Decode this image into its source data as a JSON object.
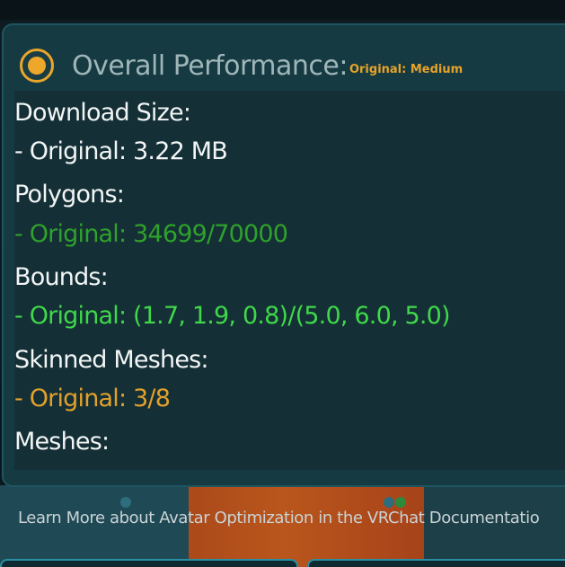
{
  "performance": {
    "title": "Overall Performance:",
    "rating_badge": "Original: Medium",
    "rating_color": "#e9a62a",
    "icon": "performance-rating-icon"
  },
  "stats": [
    {
      "label": "Download Size:",
      "value": "- Original: 3.22 MB",
      "value_color": "#f2f5f5"
    },
    {
      "label": "Polygons:",
      "value": "- Original: 34699/70000",
      "value_color": "#2fa12c"
    },
    {
      "label": "Bounds:",
      "value": "- Original: (1.7, 1.9, 0.8)/(5.0, 6.0, 5.0)",
      "value_color": "#3fd84a"
    },
    {
      "label": "Skinned Meshes:",
      "value": "- Original: 3/8",
      "value_color": "#e2a12b"
    },
    {
      "label": "Meshes:"
    }
  ],
  "footer": {
    "link_text": "Learn More about Avatar Optimization in the VRChat Documentatio"
  }
}
